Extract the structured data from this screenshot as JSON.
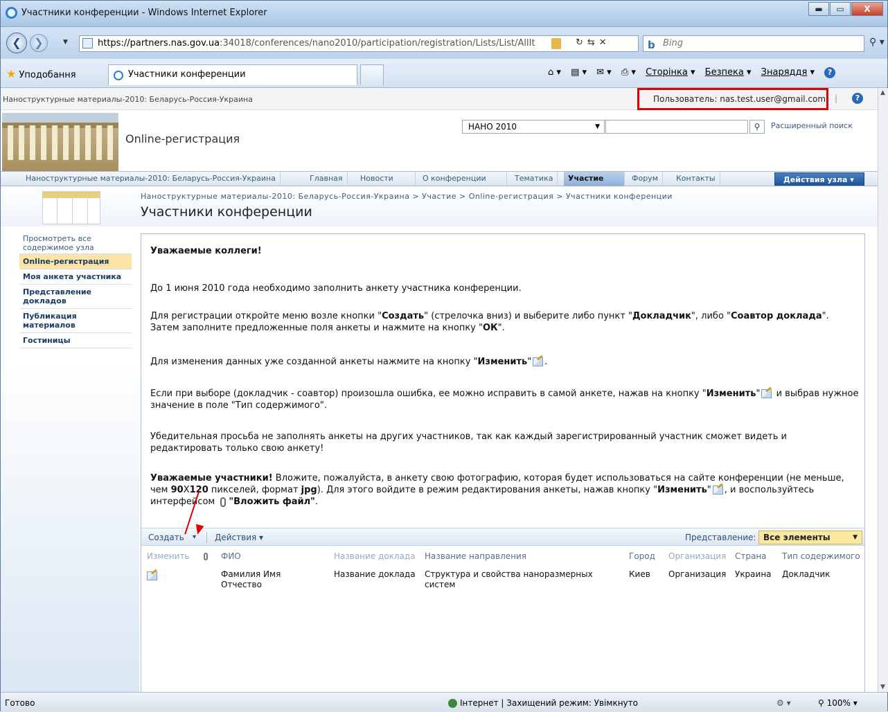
{
  "window": {
    "title": "Участники конференции - Windows Internet Explorer",
    "min": "▬",
    "max": "▭",
    "close": "X"
  },
  "browser": {
    "address_prefix": "https://",
    "address_domain": "partners.nas.gov.ua",
    "address_rest": ":34018/conferences/nano2010/participation/registration/Lists/List/AllIt",
    "search_placeholder": "Bing",
    "bing_logo": "b",
    "favorites_label": "Уподобання",
    "tab_title": "Участники конференции",
    "cmd_page": "Сторінка",
    "cmd_safety": "Безпека",
    "cmd_tools": "Знаряддя",
    "cmd_help": "?"
  },
  "site": {
    "top_title": "Наноструктурные материалы-2010: Беларусь-Россия-Украина",
    "user_label": "Пользователь: nas.test.user@gmail.com",
    "sep": "|",
    "help": "?",
    "site_title": "Online-регистрация",
    "scope_value": "НАНО 2010",
    "advanced_search": "Расширенный поиск",
    "nav": [
      {
        "label": "Наноструктурные материалы-2010: Беларусь-Россия-Украина"
      },
      {
        "label": "Главная"
      },
      {
        "label": "Новости"
      },
      {
        "label": "О конференции"
      },
      {
        "label": "Тематика"
      },
      {
        "label": "Участие"
      },
      {
        "label": "Форум"
      },
      {
        "label": "Контакты"
      }
    ],
    "site_actions": "Действия узла ▾",
    "breadcrumb": "Наноструктурные материалы-2010: Беларусь-Россия-Украина > Участие > Online-регистрация > Участники конференции",
    "page_title": "Участники конференции",
    "quick_launch": [
      {
        "label": "Просмотреть все содержимое узла"
      },
      {
        "label": "Online-регистрация"
      },
      {
        "label": "Моя анкета участника"
      },
      {
        "label": "Представление докладов"
      },
      {
        "label": "Публикация материалов"
      },
      {
        "label": "Гостиницы"
      }
    ]
  },
  "content": {
    "greeting": "Уважаемые коллеги!",
    "p1": "До 1 июня 2010 года необходимо заполнить анкету участника конференции.",
    "p2a": "Для регистрации откройте меню возле кнопки \"",
    "p2b": "Создать",
    "p2c": "\" (стрелочка вниз) и выберите либо пункт \"",
    "p2d": "Докладчик",
    "p2e": "\", либо \"",
    "p2f": "Соавтор доклада",
    "p2g": "\". Затем заполните предложенные поля анкеты и нажмите на кнопку \"",
    "p2h": "ОК",
    "p2i": "\".",
    "p3a": "Для изменения данных уже созданной анкеты нажмите на кнопку \"",
    "p3b": "Изменить",
    "p3c": "\"",
    "p4a": "Если при выборе (докладчик - соавтор) произошла ошибка, ее можно исправить в самой анкете, нажав на кнопку \"",
    "p4b": "Изменить",
    "p4c": "\"",
    "p4d": " и выбрав нужное значение в поле \"Тип содержимого\".",
    "p5": "Убедительная просьба не заполнять анкеты на других участников, так как каждый зарегистрированный участник сможет видеть и редактировать только свою анкету!",
    "p6a": "Уважаемые участники!",
    "p6b": " Вложите, пожалуйста, в анкету свою фотографию, которая будет использоваться на сайте конференции (не меньше, чем ",
    "p6c": "90",
    "p6d": "X",
    "p6e": "120",
    "p6f": " пикселей, формат ",
    "p6g": "jpg",
    "p6h": "). Для этого войдите в режим редактирования анкеты, нажав кнопку \"",
    "p6i": "Изменить",
    "p6j": "\"",
    "p6k": ", и воспользуйтесь интерфейсом ",
    "p6l": "\"Вложить файл\"",
    "p6m": "."
  },
  "list": {
    "create_label": "Создать",
    "create_arrow": "▾",
    "actions_label": "Действия ▾",
    "view_label": "Представление:",
    "view_value": "Все элементы",
    "columns": [
      "Изменить",
      "ФИО",
      "Название доклада",
      "Название направления",
      "Город",
      "Организация",
      "Страна",
      "Тип содержимого"
    ],
    "rows": [
      {
        "fio": "Фамилия Имя Отчество",
        "report": "Название доклада",
        "direction": "Структура и свойства наноразмерных систем",
        "city": "Киев",
        "org": "Организация",
        "country": "Украина",
        "type": "Докладчик"
      }
    ]
  },
  "status": {
    "left": "Готово",
    "zone": "Інтернет | Захищений режим: Увімкнуто",
    "zoom": "100%"
  }
}
